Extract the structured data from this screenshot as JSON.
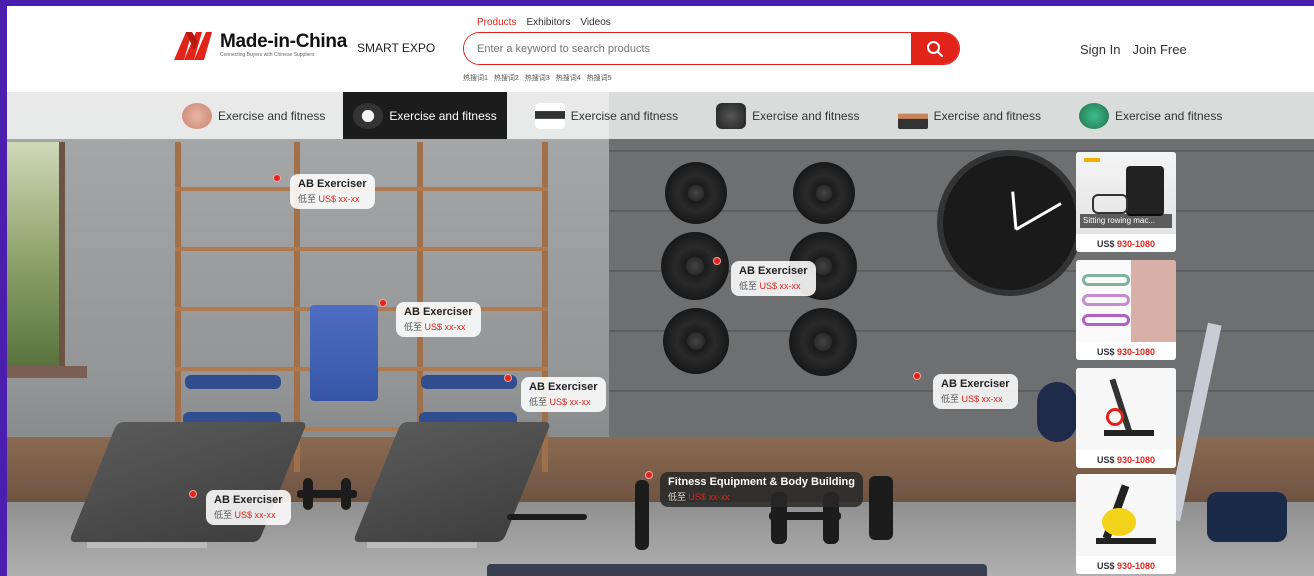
{
  "brand": {
    "name": "Made-in-China",
    "tagline": "Connecting Buyers with Chinese Suppliers",
    "smart_expo": "SMART EXPO"
  },
  "search": {
    "tabs": [
      "Products",
      "Exhibitors",
      "Videos"
    ],
    "active_tab": "Products",
    "placeholder": "Enter a keyword to search products",
    "hot_words": [
      "热搜词1",
      "热搜词2",
      "热搜词3",
      "热搜词4",
      "热搜词5"
    ]
  },
  "user": {
    "sign_in": "Sign In",
    "join_free": "Join Free"
  },
  "categories": [
    {
      "label": "Exercise and fitness",
      "icon": "chair-icon",
      "active": false
    },
    {
      "label": "Exercise and fitness",
      "icon": "treadmill-icon",
      "active": true
    },
    {
      "label": "Exercise and fitness",
      "icon": "bench-icon",
      "active": false
    },
    {
      "label": "Exercise and fitness",
      "icon": "machine-icon",
      "active": false
    },
    {
      "label": "Exercise and fitness",
      "icon": "person-icon",
      "active": false
    },
    {
      "label": "Exercise and fitness",
      "icon": "kettlebell-icon",
      "active": false
    }
  ],
  "hotspots": [
    {
      "name": "AB Exerciser",
      "price_prefix": "低至",
      "price": "US$ xx-xx"
    },
    {
      "name": "AB Exerciser",
      "price_prefix": "低至",
      "price": "US$ xx-xx"
    },
    {
      "name": "AB Exerciser",
      "price_prefix": "低至",
      "price": "US$ xx-xx"
    },
    {
      "name": "AB Exerciser",
      "price_prefix": "低至",
      "price": "US$ xx-xx"
    },
    {
      "name": "AB Exerciser",
      "price_prefix": "低至",
      "price": "US$ xx-xx"
    },
    {
      "name": "AB Exerciser",
      "price_prefix": "低至",
      "price": "US$ xx-xx"
    },
    {
      "name": "Fitness Equipment & Body Building",
      "price_prefix": "低至",
      "price": "US$ xx-xx"
    }
  ],
  "products": [
    {
      "caption": "Sitting rowing mac...",
      "price_currency": "US$",
      "price": "930-1080",
      "icon": "rowing-machine-icon"
    },
    {
      "caption": "",
      "price_currency": "US$",
      "price": "930-1080",
      "icon": "resistance-bands-icon"
    },
    {
      "caption": "",
      "price_currency": "US$",
      "price": "930-1080",
      "icon": "spin-bike-icon"
    },
    {
      "caption": "",
      "price_currency": "US$",
      "price": "930-1080",
      "icon": "exercise-bike-icon"
    }
  ],
  "colors": {
    "accent": "#e2231a",
    "outer_border": "#4a1fb0",
    "active_category_bg": "#1c1c1c"
  }
}
